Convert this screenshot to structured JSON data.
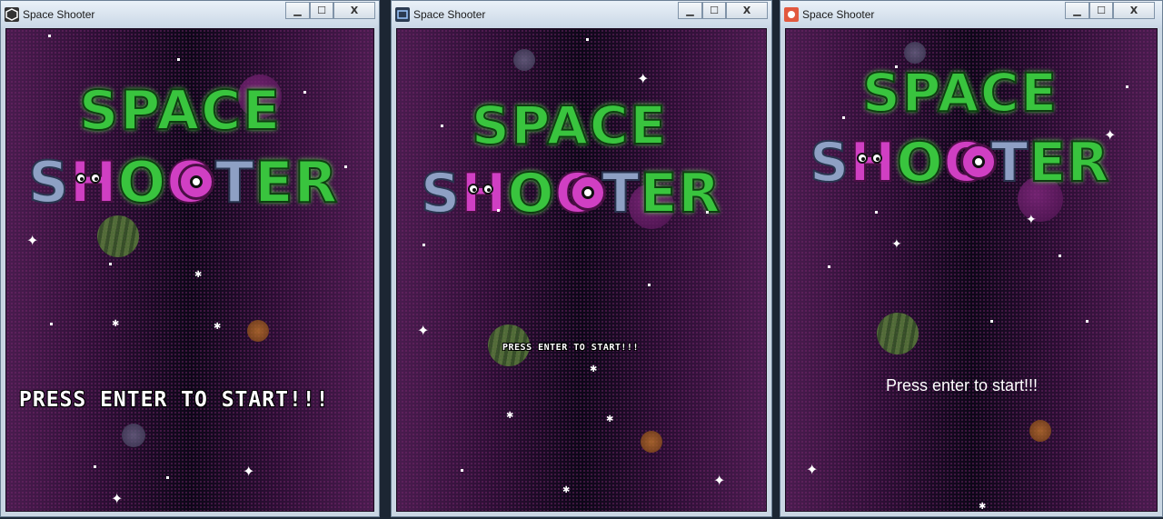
{
  "windows": [
    {
      "id": "unity",
      "title": "Space Shooter",
      "icon": "unity-icon",
      "controls": {
        "minimize": "▁",
        "maximize": "☐",
        "close": "X"
      },
      "logo": {
        "line1": "SPACE",
        "line2_s": "S",
        "line2_h": "H",
        "line2_o1": "O",
        "line2_o2": "O",
        "line2_t": "T",
        "line2_e": "E",
        "line2_r": "R"
      },
      "prompt": "PRESS ENTER TO START!!!"
    },
    {
      "id": "godot",
      "title": "Space Shooter",
      "icon": "window-icon",
      "controls": {
        "minimize": "▁",
        "maximize": "☐",
        "close": "X"
      },
      "logo": {
        "line1": "SPACE",
        "line2_s": "S",
        "line2_h": "H",
        "line2_o1": "O",
        "line2_o2": "O",
        "line2_t": "T",
        "line2_e": "E",
        "line2_r": "R"
      },
      "prompt": "PRESS ENTER TO START!!!"
    },
    {
      "id": "love",
      "title": "Space Shooter",
      "icon": "love2d-icon",
      "controls": {
        "minimize": "▁",
        "maximize": "☐",
        "close": "X"
      },
      "logo": {
        "line1": "SPACE",
        "line2_s": "S",
        "line2_h": "H",
        "line2_o1": "O",
        "line2_o2": "O",
        "line2_t": "T",
        "line2_e": "E",
        "line2_r": "R"
      },
      "prompt": "Press enter to start!!!"
    }
  ],
  "colors": {
    "logo_green": "#39c43e",
    "logo_steel": "#8ea0c4",
    "logo_pink": "#d03fc3",
    "space_dark": "#0d0718",
    "space_purple": "#4a1c4f"
  }
}
